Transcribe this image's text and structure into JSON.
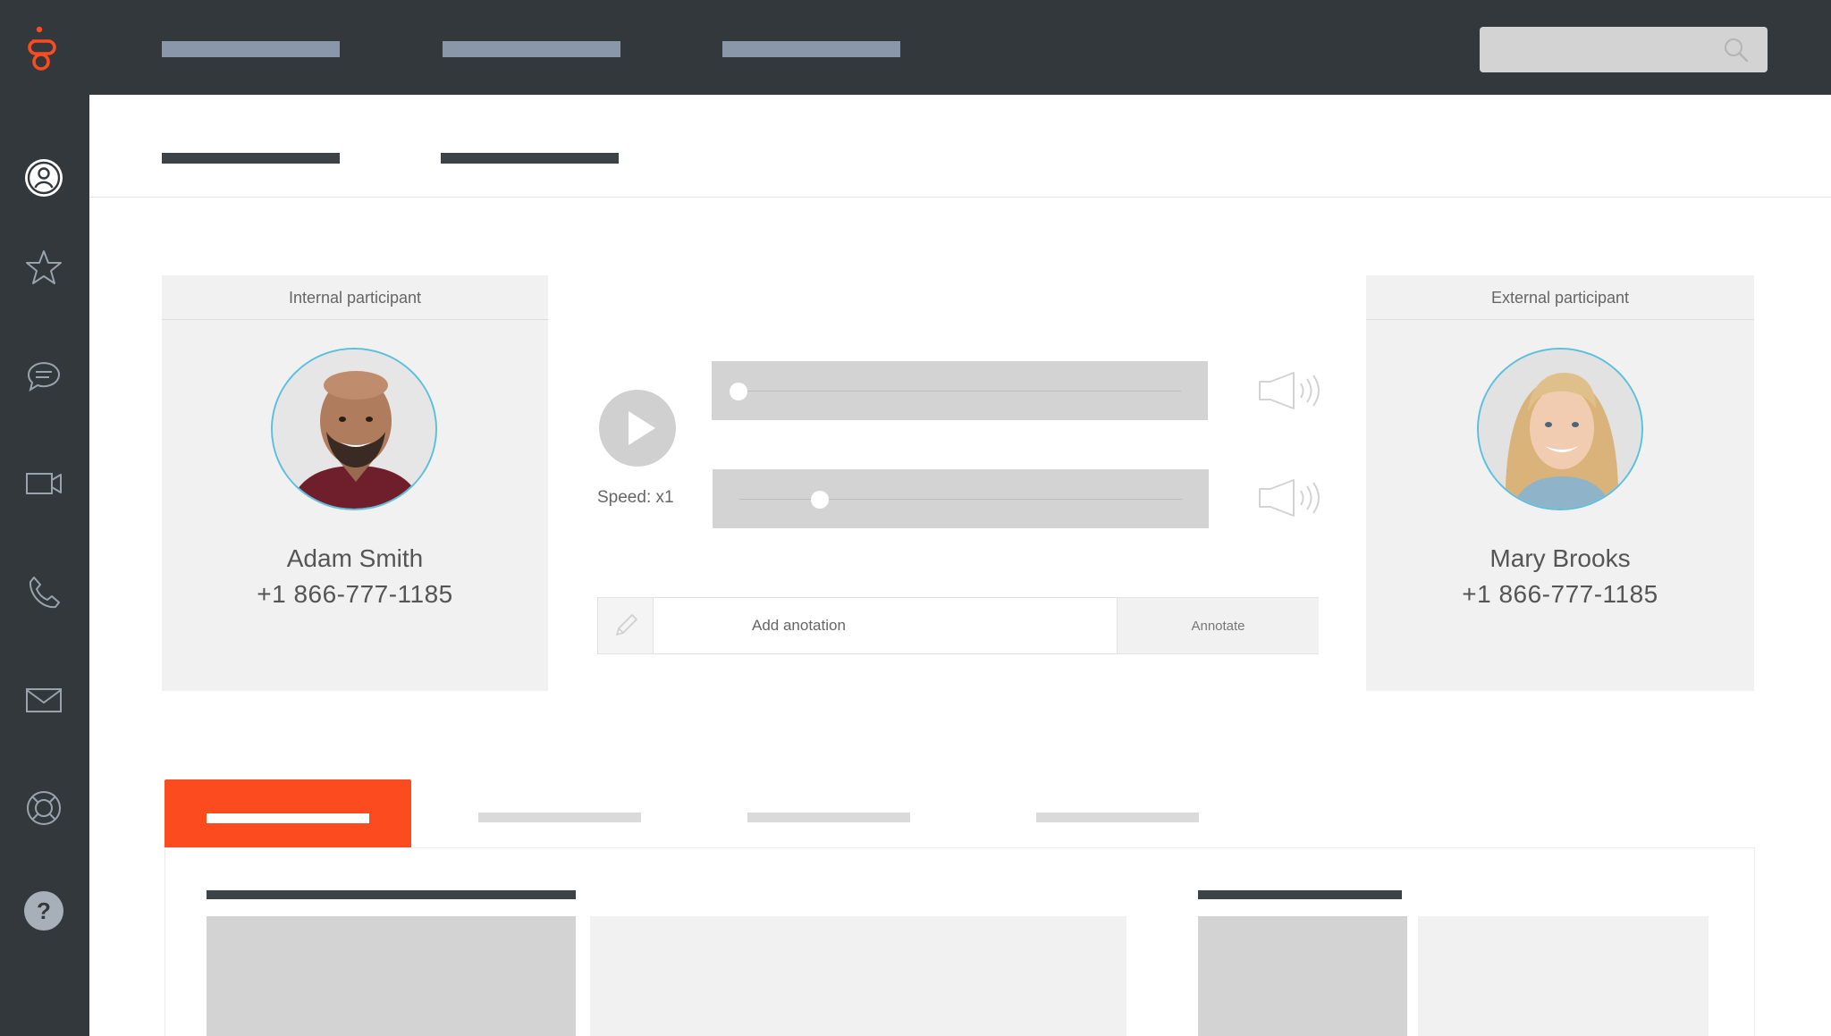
{
  "app": {
    "brand_color": "#fc4c1f",
    "logo_icon": "genesys-logo-icon",
    "accent_color": "#5bc0de",
    "topbar_color": "#33383d"
  },
  "top_nav": {
    "items": [
      "",
      "",
      ""
    ],
    "search": {
      "placeholder": "",
      "icon": "search-icon"
    }
  },
  "sidebar": {
    "items": [
      {
        "icon": "user-profile-icon",
        "active": true
      },
      {
        "icon": "star-icon"
      },
      {
        "icon": "chat-bubble-icon"
      },
      {
        "icon": "video-camera-icon"
      },
      {
        "icon": "phone-icon"
      },
      {
        "icon": "mail-icon"
      },
      {
        "icon": "lifebuoy-icon"
      },
      {
        "icon": "help-icon",
        "glyph": "?"
      }
    ]
  },
  "internal": {
    "header": "Internal participant",
    "name": "Adam Smith",
    "phone": "+1 866-777-1185"
  },
  "external": {
    "header": "External participant",
    "name": "Mary Brooks",
    "phone": "+1 866-777-1185"
  },
  "player": {
    "speed_label": "Speed: x1",
    "track1_position": 0.0,
    "track2_position": 0.19,
    "play_icon": "play-icon",
    "volume_icon": "speaker-volume-icon"
  },
  "annotation": {
    "placeholder": "Add anotation",
    "button_label": "Annotate",
    "icon": "pencil-icon"
  },
  "tabs": {
    "active_index": 0,
    "items": [
      "",
      "",
      "",
      ""
    ]
  }
}
